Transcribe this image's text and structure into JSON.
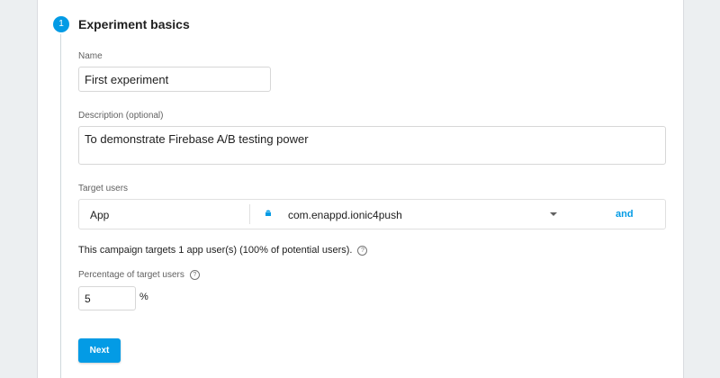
{
  "step": {
    "number": "1",
    "title": "Experiment basics"
  },
  "name_field": {
    "label": "Name",
    "value": "First experiment"
  },
  "description_field": {
    "label": "Description (optional)",
    "value": "To demonstrate Firebase A/B testing power"
  },
  "target_users": {
    "label": "Target users",
    "type": "App",
    "package": "com.enappd.ionic4push",
    "and_label": "and"
  },
  "summary": {
    "text": "This campaign targets 1 app user(s) (100% of potential users)."
  },
  "percentage": {
    "label": "Percentage of target users",
    "value": "5",
    "unit": "%"
  },
  "next_button": {
    "label": "Next"
  },
  "colors": {
    "accent": "#039be5",
    "background": "#eceff1"
  }
}
